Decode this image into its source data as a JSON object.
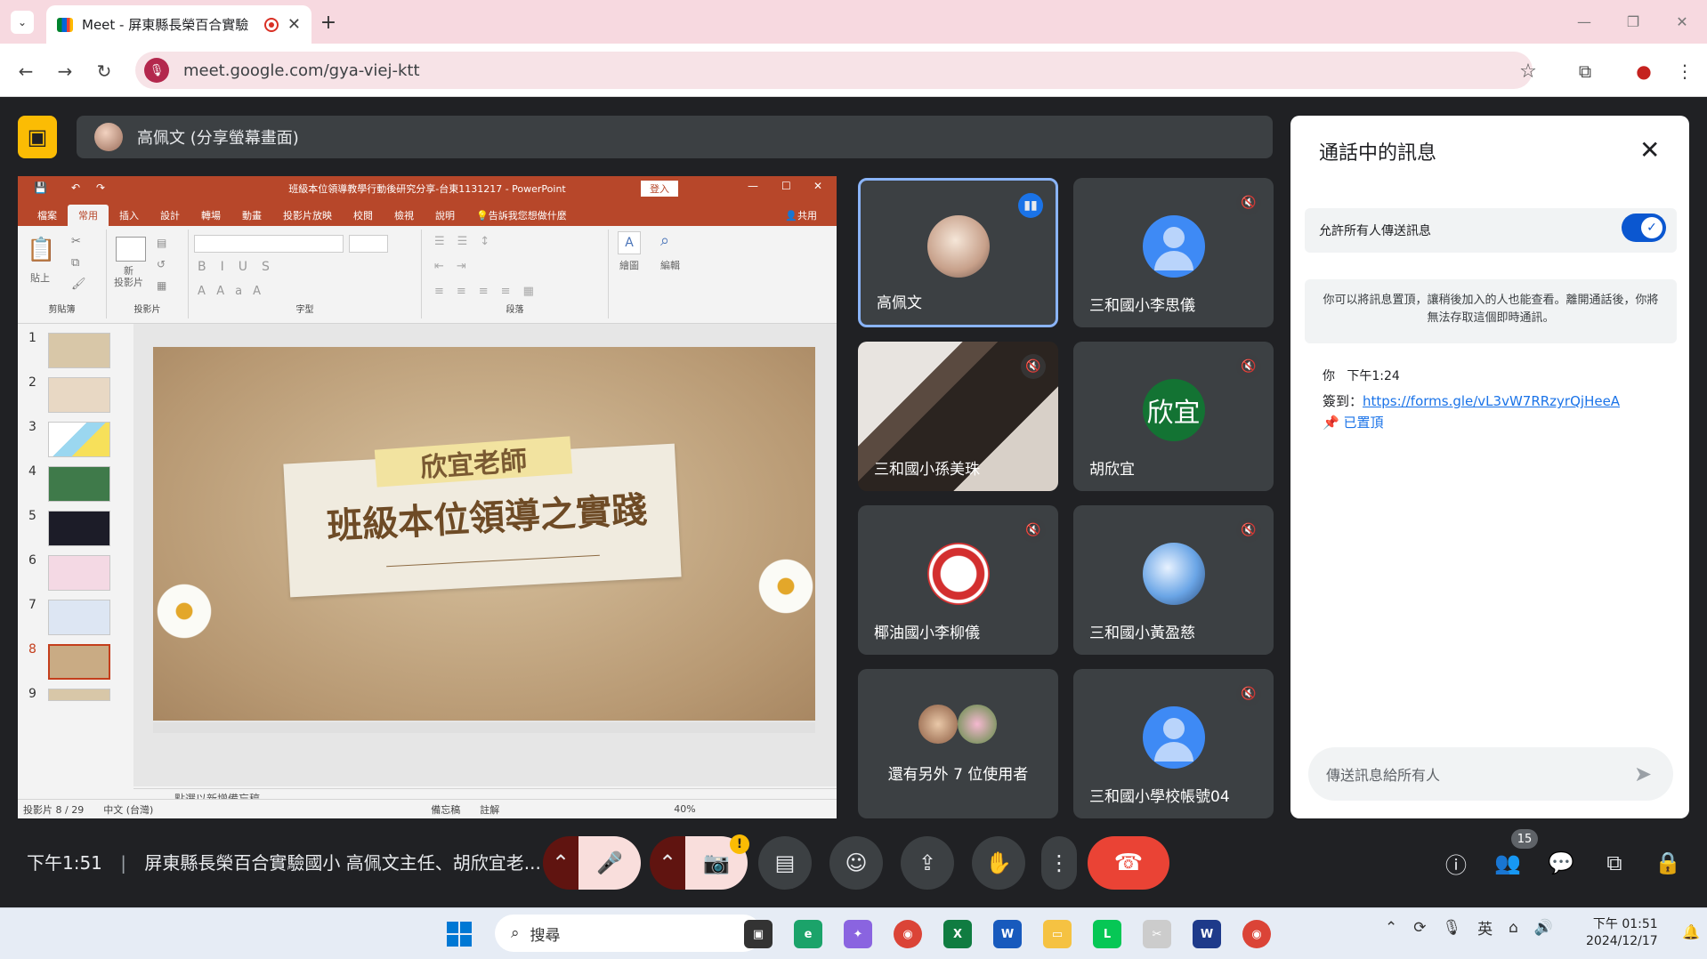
{
  "browser": {
    "tab_title": "Meet - 屏東縣長榮百合實驗",
    "url": "meet.google.com/gya-viej-ktt"
  },
  "presenter_bar": {
    "label": "高佩文 (分享螢幕畫面)"
  },
  "ppt": {
    "title": "班級本位領導教學行動後研究分享-台東1131217 - PowerPoint",
    "login": "登入",
    "tabs": [
      "檔案",
      "常用",
      "插入",
      "設計",
      "轉場",
      "動畫",
      "投影片放映",
      "校閱",
      "檢視",
      "說明"
    ],
    "tell_me": "告訴我您想做什麼",
    "share": "共用",
    "groups": {
      "clipboard": "剪貼簿",
      "slides": "投影片",
      "font": "字型",
      "paragraph": "段落",
      "paste": "貼上",
      "new_slide": "新\n投影片",
      "editing": "編輯",
      "drawing": "繪圖"
    },
    "thumb_numbers": [
      "1",
      "2",
      "3",
      "4",
      "5",
      "6",
      "7",
      "8",
      "9"
    ],
    "slide": {
      "tape_text": "欣宜老師",
      "title": "班級本位領導之實踐"
    },
    "notes_placeholder": "點選以新增備忘稿",
    "status": {
      "slide_count": "投影片 8 / 29",
      "language": "中文 (台灣)",
      "notes": "備忘稿",
      "comments": "註解",
      "zoom": "40%"
    }
  },
  "participants": [
    {
      "name": "高佩文",
      "avatar": "photo",
      "speaking": true
    },
    {
      "name": "三和國小李思儀",
      "avatar": "generic",
      "muted": true
    },
    {
      "name": "三和國小孫美珠",
      "avatar": "video",
      "muted": true
    },
    {
      "name": "胡欣宜",
      "avatar": "text",
      "initials": "欣宜",
      "muted": true
    },
    {
      "name": "椰油國小李柳儀",
      "avatar": "logo",
      "muted": true
    },
    {
      "name": "三和國小黃盈慈",
      "avatar": "photo",
      "muted": true
    },
    {
      "name": "還有另外 7 位使用者",
      "avatar": "group"
    },
    {
      "name": "三和國小學校帳號04",
      "avatar": "generic",
      "muted": true
    }
  ],
  "chat": {
    "title": "通話中的訊息",
    "allow_label": "允許所有人傳送訊息",
    "pin_info": "你可以將訊息置頂，讓稍後加入的人也能查看。離開通話後，你將無法存取這個即時通訊。",
    "message": {
      "sender": "你",
      "time": "下午1:24",
      "prefix": "簽到：",
      "link": "https://forms.gle/vL3vW7RRzyrQjHeeA",
      "pinned_label": "已置頂"
    },
    "input_placeholder": "傳送訊息給所有人"
  },
  "bottom_bar": {
    "time": "下午1:51",
    "meeting_title": "屏東縣長榮百合實驗國小 高佩文主任、胡欣宜老...",
    "people_count": "15"
  },
  "taskbar": {
    "search_placeholder": "搜尋",
    "ime": "英",
    "clock_time": "下午 01:51",
    "clock_date": "2024/12/17"
  },
  "colors": {
    "accent": "#0b57d0",
    "end_call": "#ea4335",
    "ppt_brand": "#b7472a",
    "present_highlight": "#8ab4f8"
  }
}
